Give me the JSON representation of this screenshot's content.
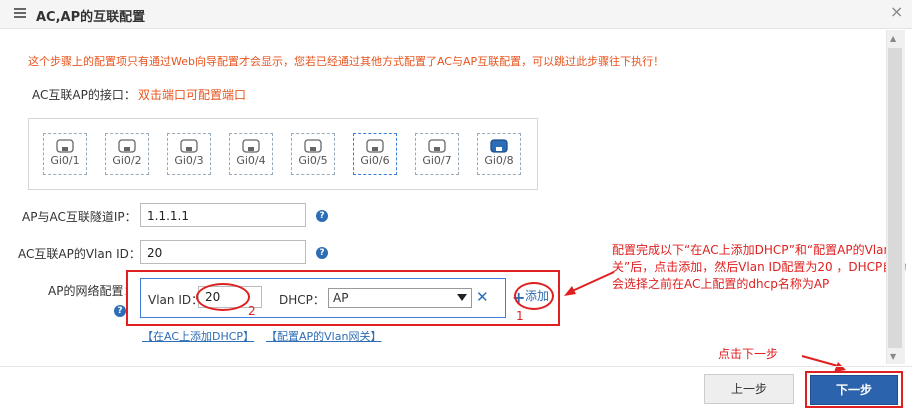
{
  "window": {
    "title": "AC,AP的互联配置",
    "close": "×"
  },
  "notice": "这个步骤上的配置项只有通过Web向导配置才会显示，您若已经通过其他方式配置了AC与AP互联配置，可以跳过此步骤往下执行！",
  "interface": {
    "label": "AC互联AP的接口：",
    "hint": "双击端口可配置端口",
    "ports": [
      "Gi0/1",
      "Gi0/2",
      "Gi0/3",
      "Gi0/4",
      "Gi0/5",
      "Gi0/6",
      "Gi0/7",
      "Gi0/8"
    ]
  },
  "tunnel": {
    "label": "AP与AC互联隧道IP：",
    "value": "1.1.1.1"
  },
  "vlan": {
    "label": "AC互联AP的Vlan ID：",
    "value": "20"
  },
  "network": {
    "label": "AP的网络配置：",
    "vlan_label": "Vlan ID：",
    "vlan_value": "20",
    "dhcp_label": "DHCP：",
    "dhcp_value": "AP",
    "add_label": "添加",
    "marker1": "1",
    "marker2": "2"
  },
  "links": {
    "add_dhcp": "【在AC上添加DHCP】",
    "gateway": "【配置AP的Vlan网关】"
  },
  "annotations": {
    "main": "配置完成以下“在AC上添加DHCP”和“配置AP的Vlan网关”后，点击添加，然后Vlan ID配置为20 ，DHCP自动会选择之前在AC上配置的dhcp名称为AP",
    "next_step": "点击下一步"
  },
  "buttons": {
    "prev": "上一步",
    "next": "下一步"
  },
  "colors": {
    "accent": "#2c63ad",
    "warning": "#e8541e",
    "annotation": "#e02020"
  }
}
